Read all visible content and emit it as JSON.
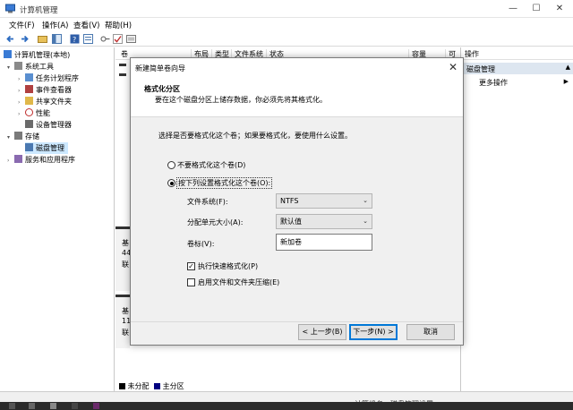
{
  "window": {
    "title": "计算机管理",
    "min": "—",
    "max": "☐",
    "close": "✕"
  },
  "menu": [
    "文件(F)",
    "操作(A)",
    "查看(V)",
    "帮助(H)"
  ],
  "tree": {
    "root": "计算机管理(本地)",
    "system_tools": "系统工具",
    "task_scheduler": "任务计划程序",
    "event_viewer": "事件查看器",
    "shared_folders": "共享文件夹",
    "performance": "性能",
    "device_manager": "设备管理器",
    "storage": "存储",
    "disk_management": "磁盘管理",
    "services_apps": "服务和应用程序"
  },
  "columns": [
    "卷",
    "布局",
    "类型",
    "文件系统",
    "状态",
    "容量",
    "可"
  ],
  "disk_rows": [
    {
      "l1": "基",
      "l2": "44",
      "l3": "联"
    },
    {
      "l1": "基",
      "l2": "11",
      "l3": "联"
    }
  ],
  "legend": {
    "unallocated": "未分配",
    "primary": "主分区"
  },
  "actions": {
    "header": "操作",
    "section": "磁盘管理",
    "more": "更多操作"
  },
  "status_text": "计算机名，磁盘管理设置",
  "colors": {
    "unallocated": "#000000",
    "primary": "#000080",
    "accent": "#0078d7",
    "selected": "#cce8ff"
  },
  "dialog": {
    "title": "新建简单卷向导",
    "close": "✕",
    "header_title": "格式化分区",
    "header_desc": "要在这个磁盘分区上储存数据，你必须先将其格式化。",
    "question": "选择是否要格式化这个卷；如果要格式化，要使用什么设置。",
    "opt_no_format": "不要格式化这个卷(D)",
    "opt_format": "按下列设置格式化这个卷(O):",
    "fs_label": "文件系统(F):",
    "fs_value": "NTFS",
    "alloc_label": "分配单元大小(A):",
    "alloc_value": "默认值",
    "vol_label": "卷标(V):",
    "vol_value": "新加卷",
    "quick_format": "执行快速格式化(P)",
    "compression": "启用文件和文件夹压缩(E)",
    "back": "< 上一步(B)",
    "next": "下一步(N) >",
    "cancel": "取消"
  }
}
